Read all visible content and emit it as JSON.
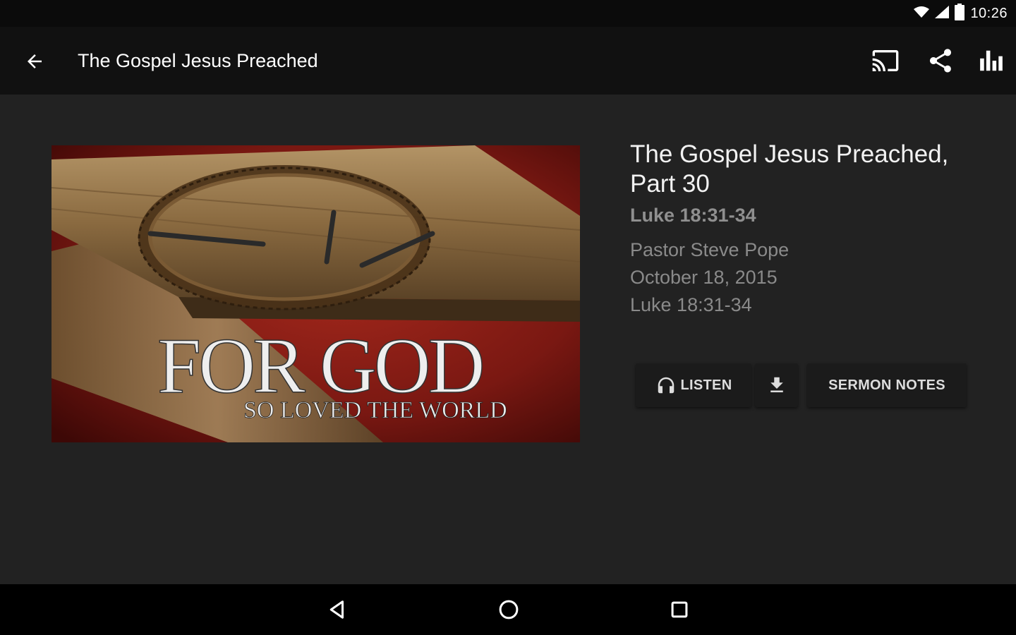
{
  "status_bar": {
    "time": "10:26",
    "icons": [
      "wifi-icon",
      "signal-icon",
      "battery-icon"
    ]
  },
  "app_bar": {
    "title": "The Gospel Jesus Preached",
    "actions": [
      "cast-icon",
      "share-icon",
      "stats-icon"
    ]
  },
  "artwork": {
    "line1": "FOR GOD",
    "line2": "SO LOVED THE WORLD"
  },
  "sermon": {
    "title": "The Gospel Jesus Preached, Part 30",
    "passage": "Luke 18:31-34",
    "speaker": "Pastor Steve Pope",
    "date": "October 18, 2015",
    "reference": "Luke 18:31-34"
  },
  "buttons": {
    "listen": "LISTEN",
    "sermon_notes": "SERMON NOTES"
  },
  "colors": {
    "background": "#222222",
    "app_bar": "#111111",
    "status_bar": "#0b0b0b",
    "nav_bar": "#000000",
    "artwork_red": "#8a1a14"
  }
}
